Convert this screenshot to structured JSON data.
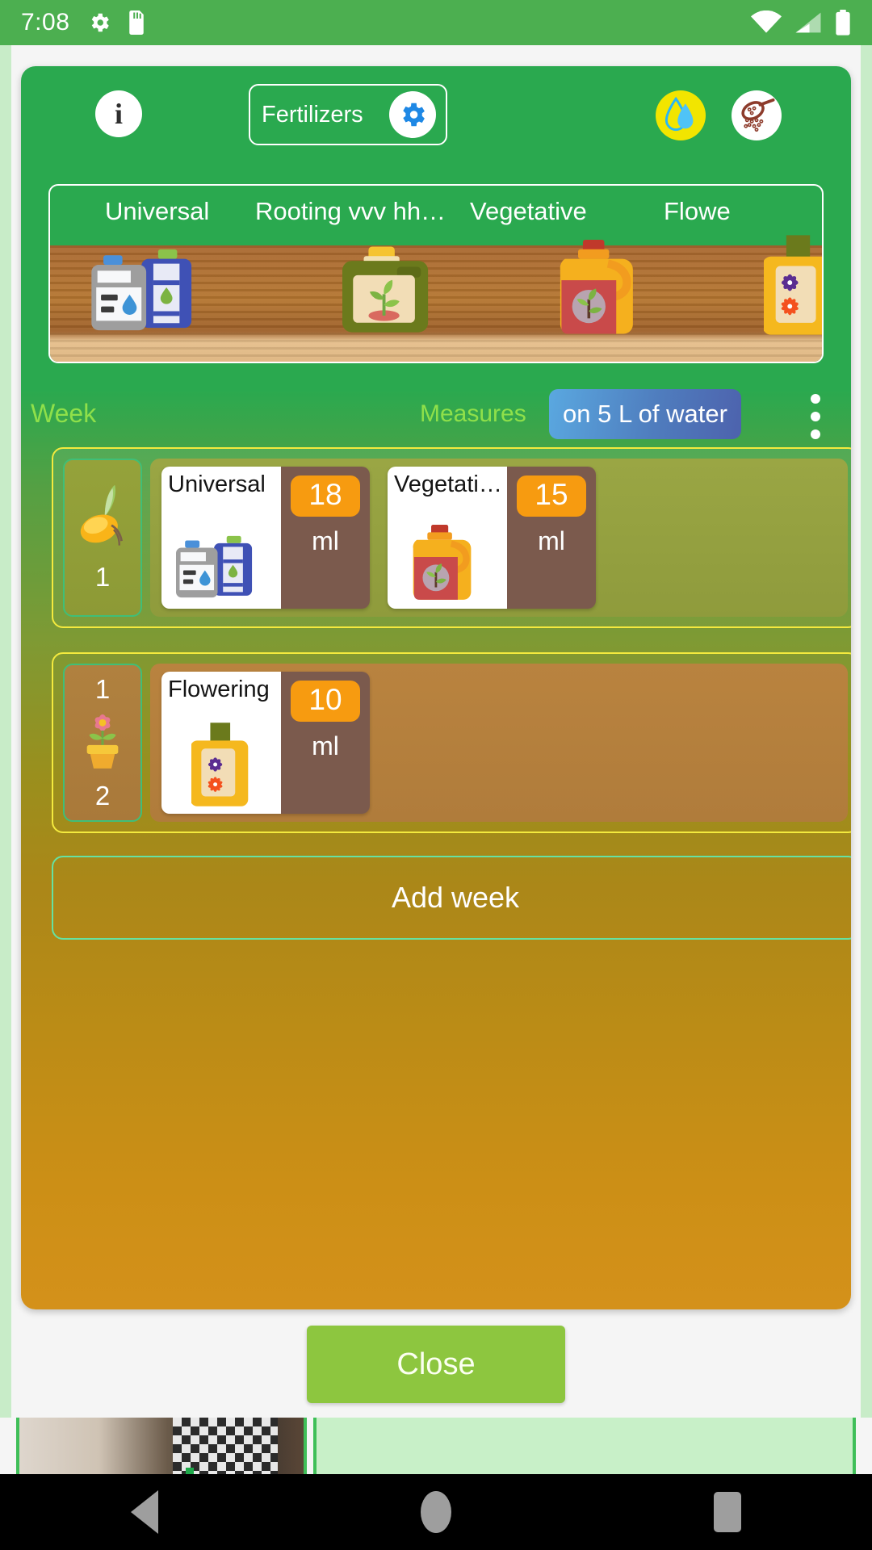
{
  "statusbar": {
    "time": "7:08",
    "icons": [
      "settings-gear-icon",
      "sdcard-icon",
      "wifi-icon",
      "cellular-signal-icon",
      "battery-icon"
    ]
  },
  "header": {
    "info_label": "i",
    "fertilizers_label": "Fertilizers",
    "gear_icon": "gear-icon",
    "water_icon": "water-drop-icon",
    "spoon_icon": "spoon-powder-icon"
  },
  "shelf": {
    "products": [
      {
        "name": "Universal",
        "icon": "universal-canister-icon"
      },
      {
        "name": "Rooting vvv hh…",
        "icon": "rooting-canister-icon"
      },
      {
        "name": "Vegetative",
        "icon": "vegetative-jug-icon"
      },
      {
        "name": "Flowe",
        "icon": "flowering-bottle-icon"
      }
    ]
  },
  "measures": {
    "week_label": "Week",
    "measures_label": "Measures",
    "water_basis": "on 5 L of water",
    "overflow_menu": "overflow-menu-icon"
  },
  "weeks": [
    {
      "numbers": [
        "1"
      ],
      "stage_icon": "sprouting-seed-icon",
      "doses": [
        {
          "name": "Universal",
          "value": "18",
          "unit": "ml",
          "icon": "universal-canister-icon"
        },
        {
          "name": "Vegetati…",
          "value": "15",
          "unit": "ml",
          "icon": "vegetative-jug-icon"
        }
      ]
    },
    {
      "numbers": [
        "1",
        "2"
      ],
      "stage_icon": "potted-flower-icon",
      "doses": [
        {
          "name": "Flowering",
          "value": "10",
          "unit": "ml",
          "icon": "flowering-bottle-icon"
        }
      ]
    }
  ],
  "add_week_label": "Add week",
  "close_label": "Close",
  "navbar": {
    "back": "back-icon",
    "home": "home-icon",
    "recents": "recents-icon"
  },
  "colors": {
    "status_green": "#4caf50",
    "dialog_top_green": "#2aa94f",
    "dialog_bottom_orange": "#d4911a",
    "accent_yellow_border": "#f4ea3e",
    "accent_green_border": "#3fbf78",
    "dose_value_orange": "#f79b10",
    "dose_panel_brown": "#7b5a4d",
    "label_light_green": "#8fe04a",
    "close_button_green": "#8dc63f"
  }
}
